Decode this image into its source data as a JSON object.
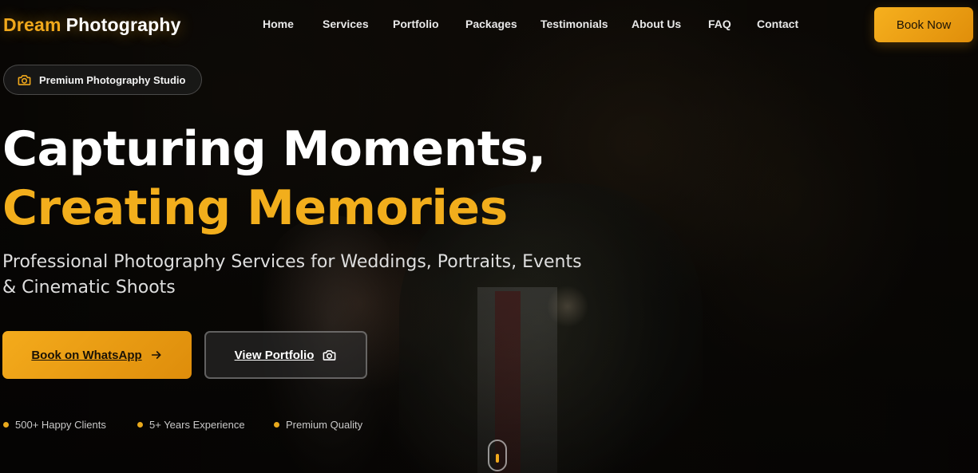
{
  "brand": {
    "part1": "Dream",
    "part2": "Photography",
    "accent_color": "#f0a81c"
  },
  "nav": {
    "items": [
      {
        "label": "Home"
      },
      {
        "label": "Services"
      },
      {
        "label": "Portfolio"
      },
      {
        "label": "Packages"
      },
      {
        "label": "Testimonials"
      },
      {
        "label": "About Us"
      },
      {
        "label": "FAQ"
      },
      {
        "label": "Contact"
      }
    ],
    "cta_label": "Book Now"
  },
  "badge": {
    "icon": "camera-icon",
    "label": "Premium Photography Studio"
  },
  "hero": {
    "headline_line1": "Capturing Moments,",
    "headline_line2": "Creating Memories",
    "subtitle": "Professional Photography Services for Weddings, Portraits, Events & Cinematic Shoots",
    "primary_button": {
      "label": "Book on WhatsApp",
      "icon": "arrow-right-icon"
    },
    "secondary_button": {
      "label": "View Portfolio",
      "icon": "camera-icon"
    }
  },
  "stats": [
    {
      "label": "500+ Happy Clients"
    },
    {
      "label": "5+ Years Experience"
    },
    {
      "label": "Premium Quality"
    }
  ],
  "scroll_indicator": {
    "icon": "mouse-scroll-icon"
  }
}
